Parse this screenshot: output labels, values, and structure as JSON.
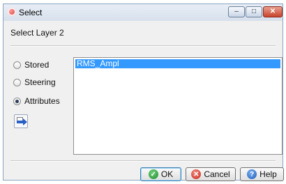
{
  "window": {
    "title": "Select",
    "controls": {
      "minimize_glyph": "–",
      "maximize_glyph": "□",
      "close_glyph": "✕"
    }
  },
  "dialog": {
    "heading": "Select Layer 2",
    "options": [
      {
        "label": "Stored",
        "selected": false
      },
      {
        "label": "Steering",
        "selected": false
      },
      {
        "label": "Attributes",
        "selected": true
      }
    ],
    "list": {
      "items": [
        "RMS_Ampl"
      ],
      "selected_index": 0
    }
  },
  "buttons": {
    "ok": "OK",
    "cancel": "Cancel",
    "help": "Help"
  },
  "icons": {
    "app": "app-icon",
    "tool": "apply-arrow-icon",
    "ok": "check-circle-icon",
    "cancel": "cancel-circle-icon",
    "help": "help-circle-icon"
  },
  "colors": {
    "selection": "#3399ff",
    "title_bar": "#d7e0ec",
    "close_button": "#c8432b"
  }
}
